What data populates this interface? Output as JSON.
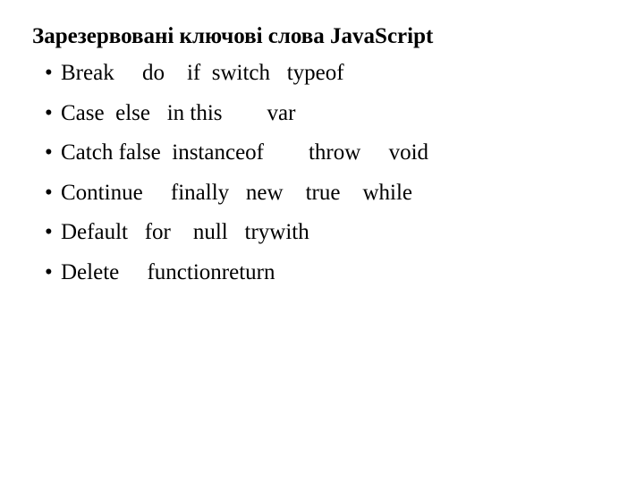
{
  "slide": {
    "title": "Зарезервовані ключові слова JavaScript",
    "bullet_marker": "•",
    "background_color": "#ffffff",
    "text_color": "#000000",
    "items": [
      {
        "text": "Break     do    if  switch   typeof"
      },
      {
        "text": "Case  else   in this        var"
      },
      {
        "text": "Catch false  instanceof        throw     void"
      },
      {
        "text": "Continue     finally   new    true    while"
      },
      {
        "text": "Default   for    null   trywith"
      },
      {
        "text": "Delete     functionreturn"
      }
    ]
  }
}
